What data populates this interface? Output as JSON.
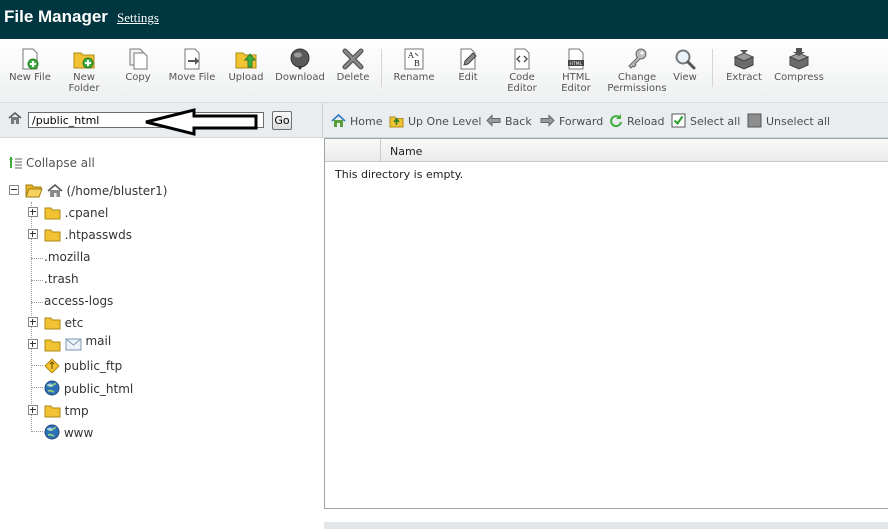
{
  "header": {
    "title": "File Manager",
    "settings_label": "Settings"
  },
  "toolbar": {
    "buttons": [
      {
        "label": "New File",
        "icon": "new-file-icon"
      },
      {
        "label": "New\nFolder",
        "icon": "new-folder-icon"
      },
      {
        "label": "Copy",
        "icon": "copy-icon"
      },
      {
        "label": "Move File",
        "icon": "move-file-icon"
      },
      {
        "label": "Upload",
        "icon": "upload-icon"
      },
      {
        "label": "Download",
        "icon": "download-icon"
      },
      {
        "label": "Delete",
        "icon": "delete-icon"
      },
      {
        "label": "Rename",
        "icon": "rename-icon"
      },
      {
        "label": "Edit",
        "icon": "edit-icon"
      },
      {
        "label": "Code\nEditor",
        "icon": "code-editor-icon"
      },
      {
        "label": "HTML\nEditor",
        "icon": "html-editor-icon"
      },
      {
        "label": "Change\nPermissions",
        "icon": "key-icon"
      },
      {
        "label": "View",
        "icon": "magnifier-icon"
      },
      {
        "label": "Extract",
        "icon": "extract-icon"
      },
      {
        "label": "Compress",
        "icon": "compress-icon"
      }
    ]
  },
  "pathbar": {
    "path_value": "/public_html",
    "go_label": "Go"
  },
  "nav": {
    "home": "Home",
    "up_one_level": "Up One Level",
    "back": "Back",
    "forward": "Forward",
    "reload": "Reload",
    "select_all": "Select all",
    "unselect_all": "Unselect all"
  },
  "tree": {
    "collapse_all": "Collapse all",
    "root": "(/home/bluster1)",
    "items": [
      {
        "label": ".cpanel",
        "type": "folder",
        "expandable": true
      },
      {
        "label": ".htpasswds",
        "type": "folder",
        "expandable": true
      },
      {
        "label": ".mozilla",
        "type": "plain",
        "expandable": false
      },
      {
        "label": ".trash",
        "type": "plain",
        "expandable": false
      },
      {
        "label": "access-logs",
        "type": "plain",
        "expandable": false
      },
      {
        "label": "etc",
        "type": "folder",
        "expandable": true
      },
      {
        "label": "mail",
        "type": "mail",
        "expandable": true
      },
      {
        "label": "public_ftp",
        "type": "ftp",
        "expandable": false
      },
      {
        "label": "public_html",
        "type": "globe",
        "expandable": false
      },
      {
        "label": "tmp",
        "type": "folder",
        "expandable": true
      },
      {
        "label": "www",
        "type": "globe",
        "expandable": false
      }
    ]
  },
  "file_list": {
    "column_name": "Name",
    "empty_message": "This directory is empty."
  },
  "colors": {
    "header_bg": "#00363f",
    "nav_bg": "#e9edf0",
    "folder": "#f1c232"
  }
}
